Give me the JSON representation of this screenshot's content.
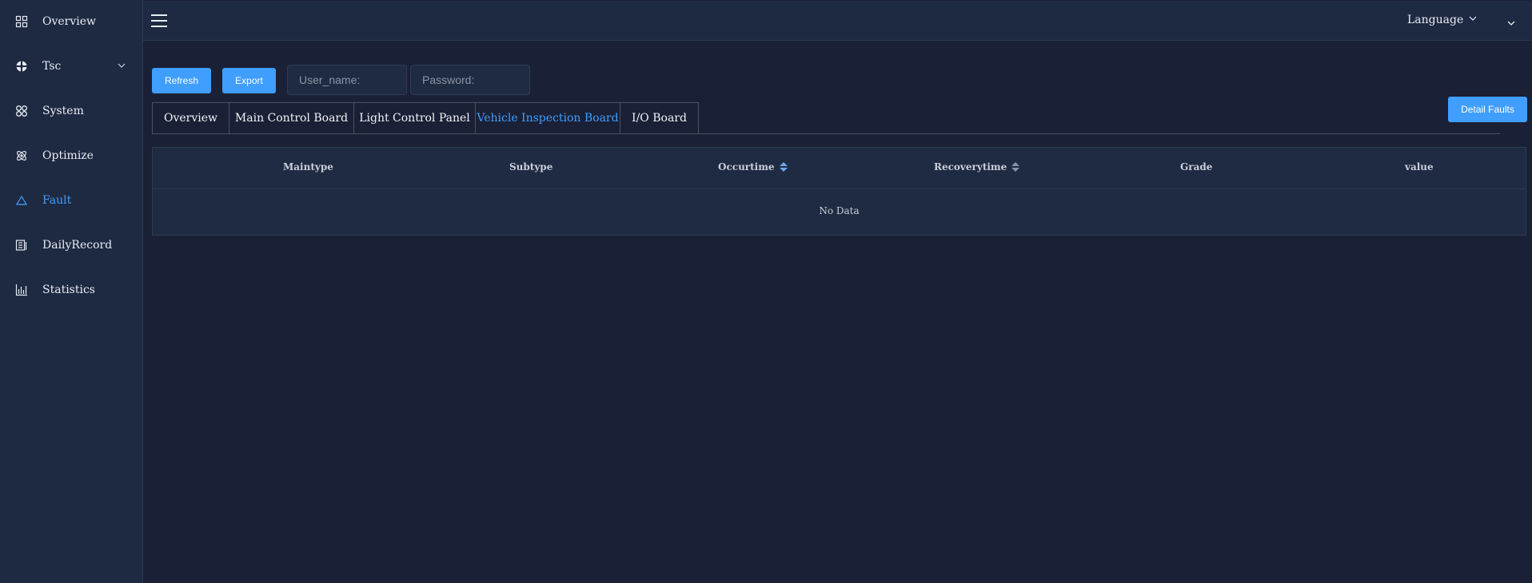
{
  "sidebar": {
    "items": [
      {
        "label": "Overview",
        "icon": "grid-icon"
      },
      {
        "label": "Tsc",
        "icon": "target-icon"
      },
      {
        "label": "System",
        "icon": "apps-icon"
      },
      {
        "label": "Optimize",
        "icon": "atom-icon"
      },
      {
        "label": "Fault",
        "icon": "warning-icon"
      },
      {
        "label": "DailyRecord",
        "icon": "record-icon"
      },
      {
        "label": "Statistics",
        "icon": "chart-icon"
      }
    ],
    "active": "Fault"
  },
  "header": {
    "language_label": "Language"
  },
  "toolbar": {
    "refresh_label": "Refresh",
    "export_label": "Export",
    "username_placeholder": "User_name:",
    "password_placeholder": "Password:",
    "detail_faults_label": "Detail Faults"
  },
  "tabs": [
    {
      "label": "Overview"
    },
    {
      "label": "Main Control Board"
    },
    {
      "label": "Light Control Panel"
    },
    {
      "label": "Vehicle Inspection Board"
    },
    {
      "label": "I/O Board"
    }
  ],
  "active_tab": "Vehicle Inspection Board",
  "table": {
    "columns": [
      "Maintype",
      "Subtype",
      "Occurtime",
      "Recoverytime",
      "Grade",
      "value"
    ],
    "rows": [],
    "empty_text": "No Data"
  },
  "colors": {
    "accent": "#409eff",
    "background": "#1a2035",
    "panel": "#1e2a42"
  }
}
